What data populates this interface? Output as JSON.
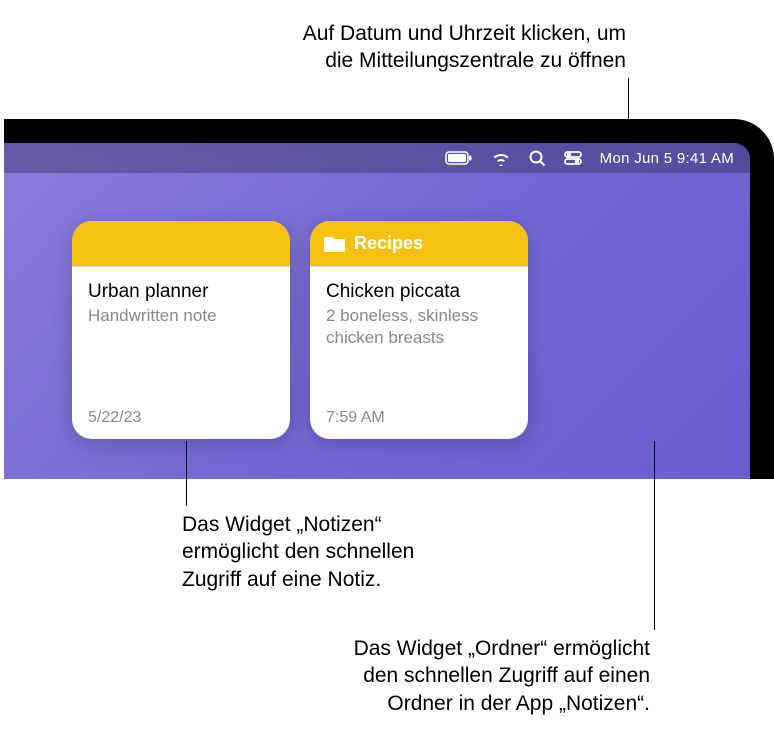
{
  "callouts": {
    "top": {
      "line1": "Auf Datum und Uhrzeit klicken, um",
      "line2": "die Mitteilungszentrale zu öffnen"
    },
    "bottom1": {
      "line1": "Das Widget „Notizen“",
      "line2": "ermöglicht den schnellen",
      "line3": "Zugriff auf eine Notiz."
    },
    "bottom2": {
      "line1": "Das Widget „Ordner“ ermöglicht",
      "line2": "den schnellen Zugriff auf einen",
      "line3": "Ordner in der App „Notizen“."
    }
  },
  "menubar": {
    "datetime": "Mon Jun 5  9:41 AM"
  },
  "widgets": {
    "note": {
      "title": "Urban planner",
      "subtitle": "Handwritten note",
      "date": "5/22/23"
    },
    "folder": {
      "header": "Recipes",
      "title": "Chicken piccata",
      "subtitle": "2 boneless, skinless chicken breasts",
      "time": "7:59 AM"
    }
  }
}
